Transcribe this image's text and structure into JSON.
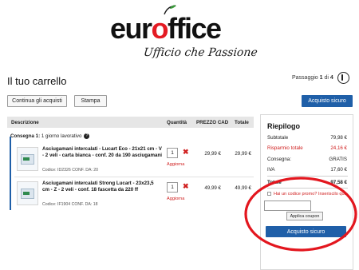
{
  "brand": {
    "word_left": "eur",
    "word_cherry": "o",
    "word_right": "ffice",
    "tagline": "Ufficio che Passione",
    "brand_red": "#e41b23"
  },
  "page": {
    "title": "Il tuo carrello",
    "step_prefix": "Passaggio ",
    "step_current": "1",
    "step_sep": " di ",
    "step_total": "4"
  },
  "toolbar": {
    "continue_label": "Continua gli acquisti",
    "print_label": "Stampa",
    "secure_purchase_label": "Acquisto sicuro",
    "accent": "#1f5fa8"
  },
  "table": {
    "headers": {
      "description": "Descrizione",
      "quantity": "Quantità",
      "price_cad": "PREZZO CAD",
      "total": "Totale"
    },
    "delivery_label": "Consegna 1:",
    "delivery_value": " 1 giorno lavorativo",
    "items": [
      {
        "name": "Asciugamani intercalati - Lucart Eco - 21x21 cm - V - 2 veli - carta bianca - conf. 20 da 190 asciugamani",
        "code": "Codice: ID2326  CONF. DA: 20",
        "qty": "1",
        "update_label": "Aggiorna",
        "unit_price": "29,99 €",
        "total": "29,99 €"
      },
      {
        "name": "Asciugamani intercalati Strong Lucart - 23x23,5 cm - Z - 2 veli - conf. 18 fascetta da 220 ff",
        "code": "Codice: IF1904  CONF. DA: 18",
        "qty": "1",
        "update_label": "Aggiorna",
        "unit_price": "49,99 €",
        "total": "49,99 €"
      }
    ]
  },
  "summary": {
    "title": "Riepilogo",
    "rows": [
      {
        "label": "Subtotale",
        "value": "79,98 €"
      },
      {
        "label": "Risparmio totale",
        "value": "24,16 €"
      },
      {
        "label": "Consegna:",
        "value": "GRATIS"
      },
      {
        "label": "IVA",
        "value": "17,60 €"
      },
      {
        "label": "Totale",
        "value": "97,58 €"
      }
    ],
    "coupon_question": "Hai un codice promo? Inseriscilo qui",
    "coupon_placeholder": "",
    "apply_coupon_label": "Applica coupon",
    "secure_purchase_label": "Acquisto sicuro",
    "savings_color": "#d02020"
  },
  "annotation": {
    "highlight_color": "#e3161e"
  }
}
